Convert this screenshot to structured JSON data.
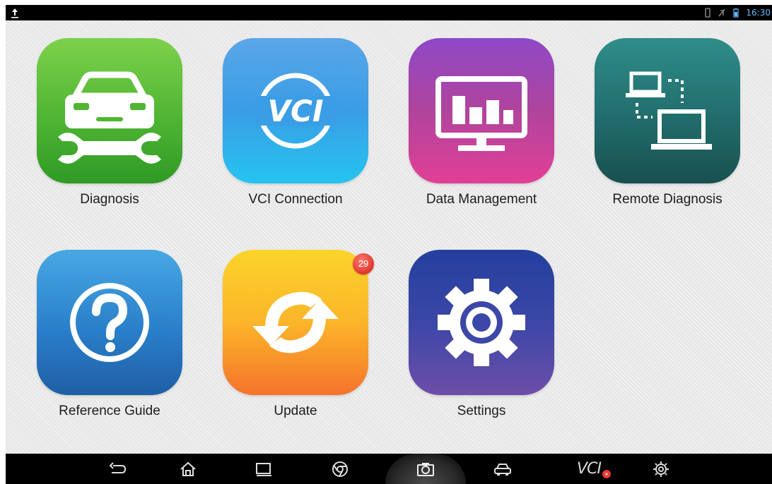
{
  "status": {
    "time": "16:30"
  },
  "apps": [
    {
      "label": "Diagnosis",
      "icon": "car-wrench-icon",
      "color": "#4fb533"
    },
    {
      "label": "VCI Connection",
      "icon": "vci-icon",
      "color": "#3a9de5"
    },
    {
      "label": "Data Management",
      "icon": "monitor-chart-icon",
      "color": "#b0449d"
    },
    {
      "label": "Remote Diagnosis",
      "icon": "laptops-icon",
      "color": "#22706f"
    },
    {
      "label": "Reference Guide",
      "icon": "question-icon",
      "color": "#2a7fca"
    },
    {
      "label": "Update",
      "icon": "sync-arrows-icon",
      "color": "#fbb52a",
      "badge": "29"
    },
    {
      "label": "Settings",
      "icon": "gear-icon",
      "color": "#3c47a7"
    }
  ],
  "vci_logo_text": "VCI",
  "navbar": {
    "items": [
      "back-icon",
      "home-icon",
      "recent-apps-icon",
      "browser-icon",
      "camera-icon",
      "car-icon",
      "vci-status-icon",
      "settings-icon"
    ],
    "vci_label": "VCI",
    "vci_status_mark": "×"
  }
}
